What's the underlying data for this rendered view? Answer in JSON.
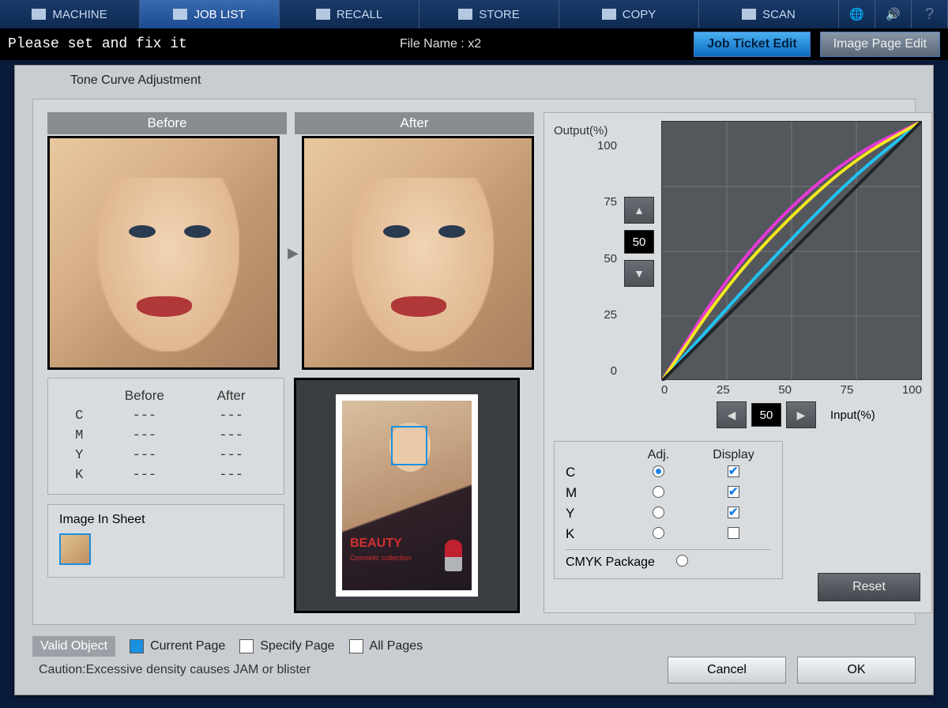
{
  "menu": {
    "items": [
      "MACHINE",
      "JOB LIST",
      "RECALL",
      "STORE",
      "COPY",
      "SCAN"
    ],
    "active": 1
  },
  "status_text": "Please set and fix it",
  "file_label": "File Name :",
  "file_name": "x2",
  "btn_job_ticket": "Job Ticket Edit",
  "btn_image_page": "Image Page Edit",
  "dialog_title": "Tone Curve Adjustment",
  "hdr_before": "Before",
  "hdr_after": "After",
  "values": {
    "cols": [
      "Before",
      "After"
    ],
    "rows": [
      {
        "ch": "C",
        "b": "---",
        "a": "---"
      },
      {
        "ch": "M",
        "b": "---",
        "a": "---"
      },
      {
        "ch": "Y",
        "b": "---",
        "a": "---"
      },
      {
        "ch": "K",
        "b": "---",
        "a": "---"
      }
    ]
  },
  "image_in_sheet": "Image In Sheet",
  "doc_overlay": {
    "title": "BEAUTY",
    "sub": "Cosmetic collection"
  },
  "output_label": "Output(%)",
  "input_label": "Input(%)",
  "y_ticks": [
    "100",
    "75",
    "50",
    "25",
    "0"
  ],
  "x_ticks": [
    "0",
    "25",
    "50",
    "75",
    "100"
  ],
  "out_val": "50",
  "in_val": "50",
  "adj": {
    "col_adj": "Adj.",
    "col_disp": "Display",
    "rows": [
      {
        "ch": "C",
        "adj": true,
        "disp": true
      },
      {
        "ch": "M",
        "adj": false,
        "disp": true
      },
      {
        "ch": "Y",
        "adj": false,
        "disp": true
      },
      {
        "ch": "K",
        "adj": false,
        "disp": false
      }
    ],
    "pkg_label": "CMYK Package",
    "pkg": false
  },
  "reset": "Reset",
  "valid_object": "Valid Object",
  "opt_current": "Current Page",
  "opt_specify": "Specify Page",
  "opt_all": "All Pages",
  "caution": "Caution:Excessive density causes JAM or blister",
  "cancel": "Cancel",
  "ok": "OK",
  "chart_data": {
    "type": "line",
    "xlabel": "Input(%)",
    "ylabel": "Output(%)",
    "xlim": [
      0,
      100
    ],
    "ylim": [
      0,
      100
    ],
    "x": [
      0,
      25,
      50,
      75,
      100
    ],
    "series": [
      {
        "name": "C",
        "color": "#20c4f4",
        "values": [
          0,
          28,
          55,
          80,
          100
        ]
      },
      {
        "name": "M",
        "color": "#e838d8",
        "values": [
          0,
          40,
          68,
          88,
          100
        ]
      },
      {
        "name": "Y",
        "color": "#f4e820",
        "values": [
          0,
          37,
          64,
          86,
          100
        ]
      },
      {
        "name": "K",
        "color": "#202428",
        "values": [
          0,
          25,
          50,
          75,
          100
        ]
      }
    ]
  }
}
